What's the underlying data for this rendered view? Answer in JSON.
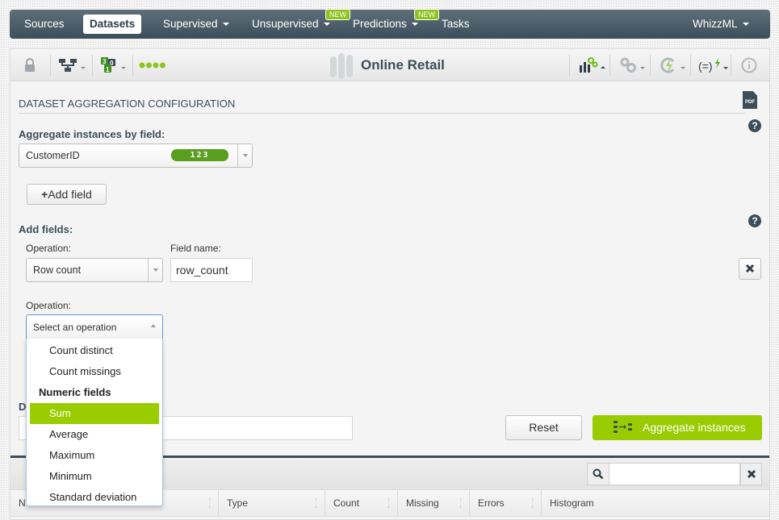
{
  "nav": {
    "items": [
      {
        "label": "Sources",
        "dropdown": false,
        "active": false
      },
      {
        "label": "Datasets",
        "dropdown": false,
        "active": true
      },
      {
        "label": "Supervised",
        "dropdown": true,
        "active": false
      },
      {
        "label": "Unsupervised",
        "dropdown": true,
        "active": false,
        "badge": "NEW"
      },
      {
        "label": "Predictions",
        "dropdown": true,
        "active": false,
        "badge": "NEW"
      },
      {
        "label": "Tasks",
        "dropdown": false,
        "active": false
      }
    ],
    "right_item": "WhizzML"
  },
  "toolbar": {
    "title": "Online Retail",
    "left_icons": [
      "lock-icon",
      "model-tree-icon",
      "field-types-icon",
      "status-dots-icon"
    ],
    "right_icons": [
      "charts-config-icon",
      "configure-icon",
      "lightning-refresh-icon",
      "formula-icon",
      "info-icon"
    ],
    "field_type_counts": {
      "numeric": "3",
      "categorical": "0",
      "text": "1"
    }
  },
  "page": {
    "section_title": "DATASET AGGREGATION CONFIGURATION",
    "pdf_label": "PDF",
    "help_glyph": "?"
  },
  "aggregate": {
    "label": "Aggregate instances by field:",
    "selected_field": "CustomerID",
    "field_type_badge": "123",
    "add_field_label": "Add field"
  },
  "add_fields": {
    "label": "Add fields:",
    "row1": {
      "operation_label": "Operation:",
      "operation_value": "Row count",
      "field_name_label": "Field name:",
      "field_name_value": "row_count"
    },
    "row2": {
      "operation_label": "Operation:",
      "placeholder": "Select an operation"
    },
    "dropdown_options": [
      {
        "label": "Count distinct",
        "type": "option"
      },
      {
        "label": "Count missings",
        "type": "option"
      },
      {
        "label": "Numeric fields",
        "type": "group"
      },
      {
        "label": "Sum",
        "type": "option",
        "highlighted": true
      },
      {
        "label": "Average",
        "type": "option"
      },
      {
        "label": "Maximum",
        "type": "option"
      },
      {
        "label": "Minimum",
        "type": "option"
      },
      {
        "label": "Standard deviation",
        "type": "option"
      }
    ]
  },
  "dataset_name": {
    "label_partial": "D",
    "value": ""
  },
  "actions": {
    "reset_label": "Reset",
    "aggregate_label": "Aggregate instances"
  },
  "table": {
    "search_value": "",
    "columns": [
      "Name",
      "Type",
      "Count",
      "Missing",
      "Errors",
      "Histogram"
    ],
    "name_col_visible": "N"
  },
  "colors": {
    "accent_green": "#99cc00",
    "badge_green": "#5a9e20",
    "navy": "#3c4e5a"
  }
}
